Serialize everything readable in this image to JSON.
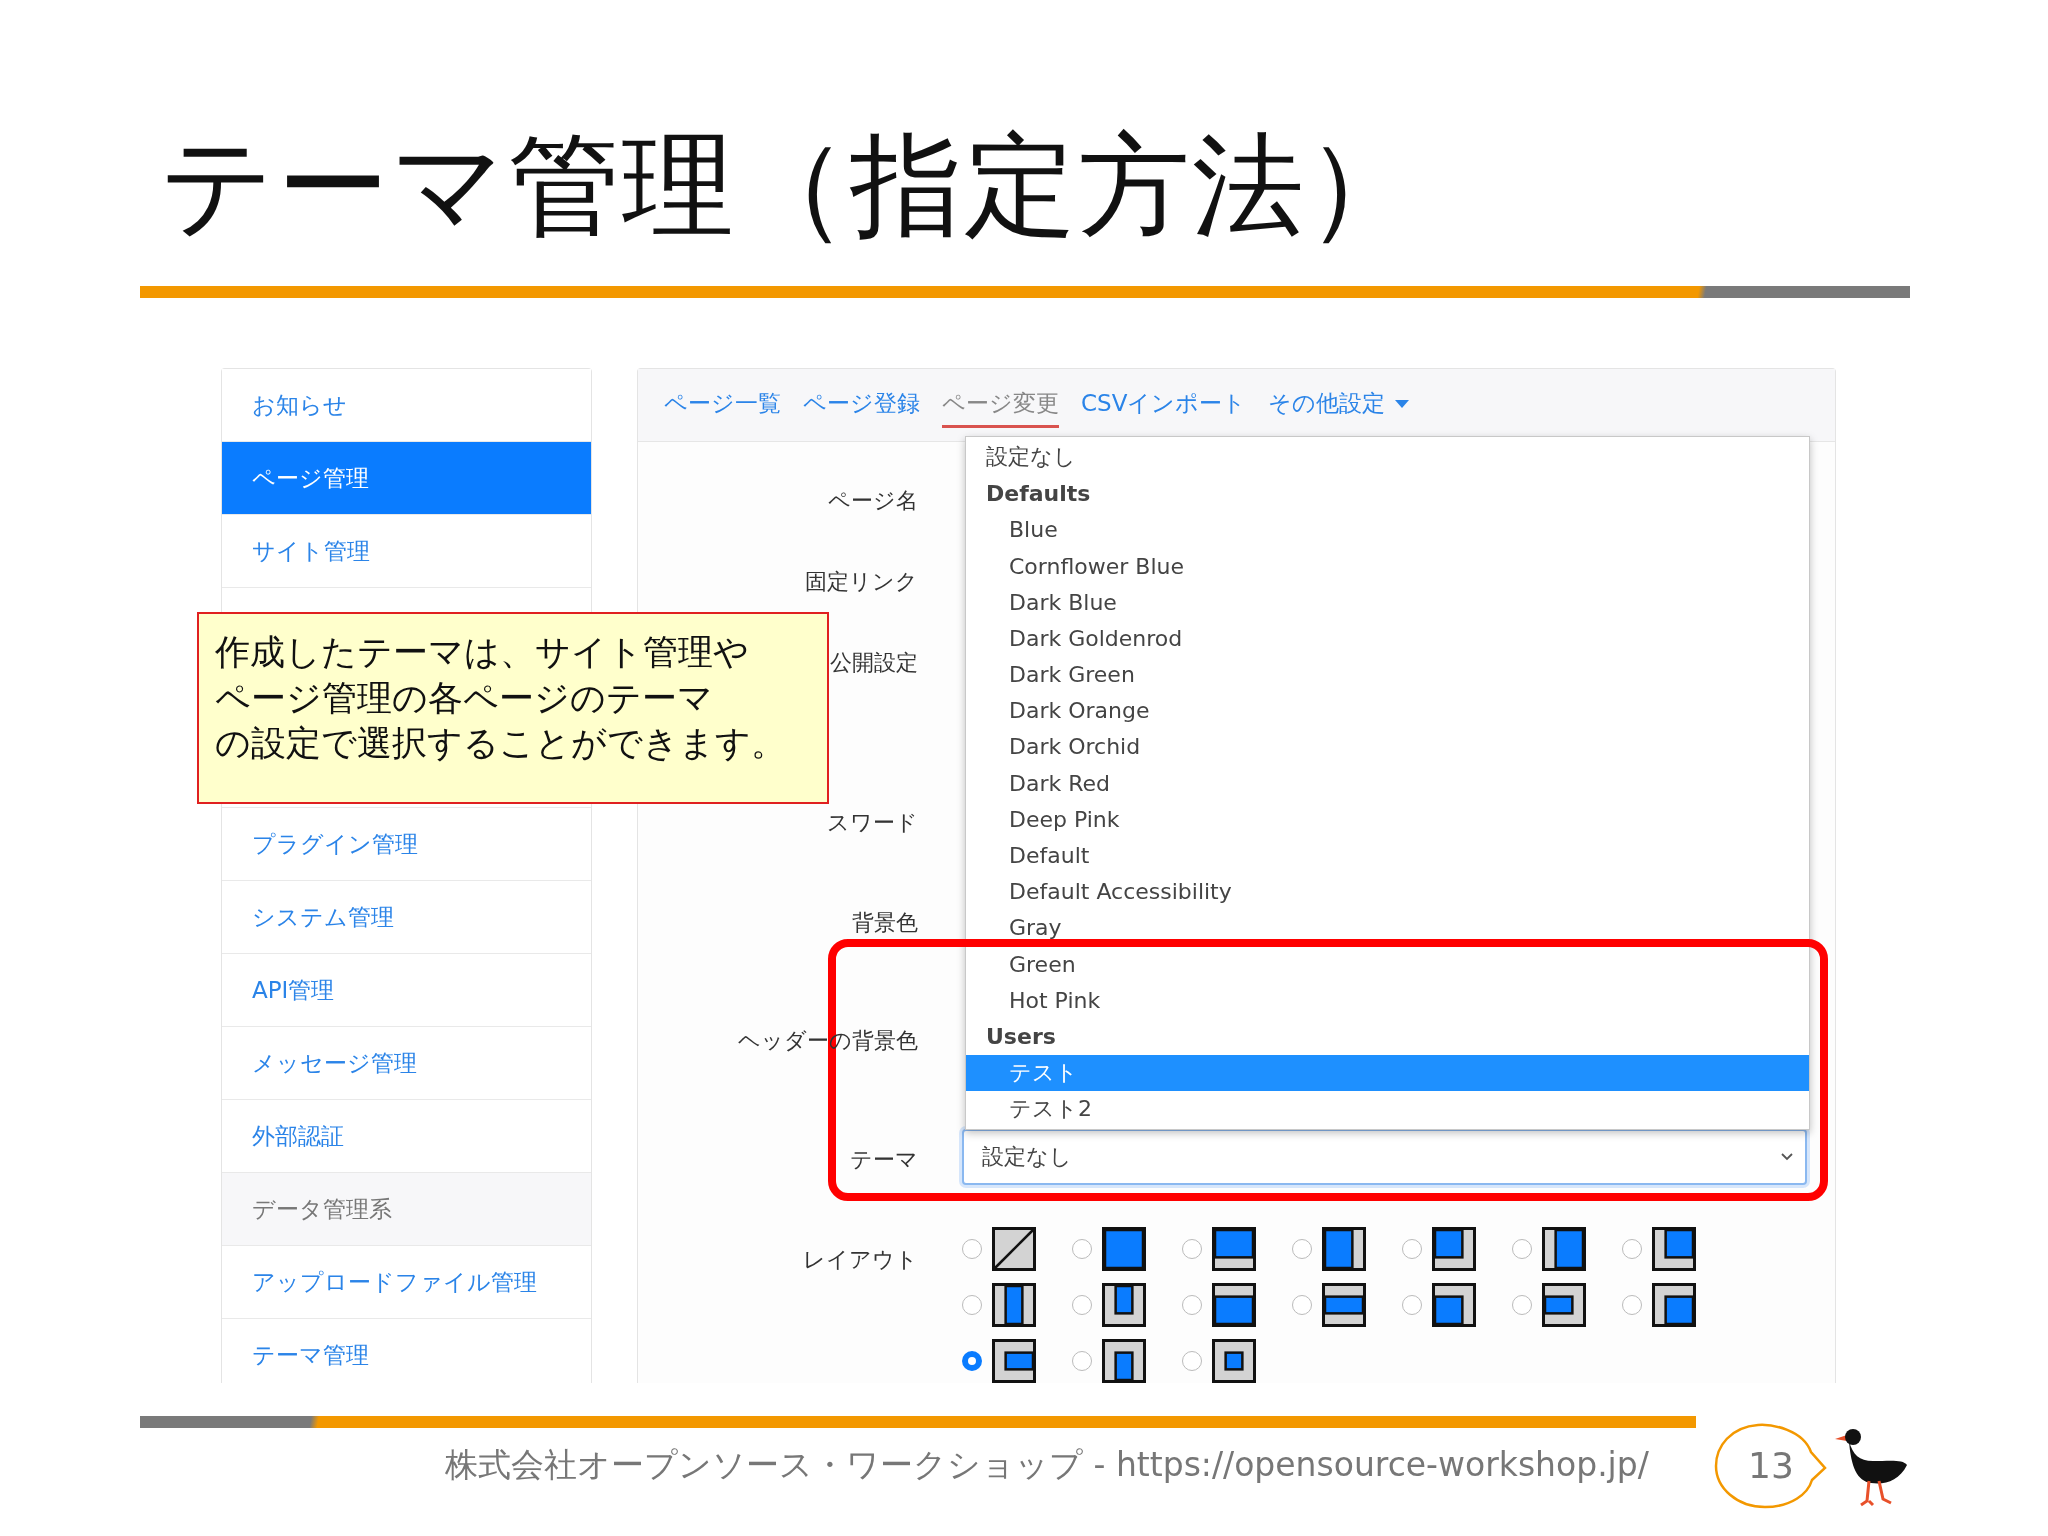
{
  "slide": {
    "title": "テーマ管理（指定方法）"
  },
  "sidebar": {
    "items": [
      {
        "label": "お知らせ",
        "kind": "link",
        "selected": false
      },
      {
        "label": "ページ管理",
        "kind": "link",
        "selected": true
      },
      {
        "label": "サイト管理",
        "kind": "link",
        "selected": false
      }
    ],
    "more_items": [
      {
        "label": "プラグイン管理",
        "kind": "link",
        "selected": false
      },
      {
        "label": "システム管理",
        "kind": "link",
        "selected": false
      },
      {
        "label": "API管理",
        "kind": "link",
        "selected": false
      },
      {
        "label": "メッセージ管理",
        "kind": "link",
        "selected": false
      },
      {
        "label": "外部認証",
        "kind": "link",
        "selected": false
      },
      {
        "label": "データ管理系",
        "kind": "header"
      },
      {
        "label": "アップロードファイル管理",
        "kind": "link",
        "selected": false
      },
      {
        "label": "テーマ管理",
        "kind": "link",
        "selected": false
      }
    ]
  },
  "tabs": [
    {
      "label": "ページ一覧",
      "selected": false,
      "has_caret": false
    },
    {
      "label": "ページ登録",
      "selected": false,
      "has_caret": false
    },
    {
      "label": "ページ変更",
      "selected": true,
      "has_caret": false
    },
    {
      "label": "CSVインポート",
      "selected": false,
      "has_caret": false
    },
    {
      "label": "その他設定",
      "selected": false,
      "has_caret": true
    }
  ],
  "form": {
    "labels": [
      "ページ名",
      "固定リンク",
      "公開設定",
      "スワード",
      "背景色",
      "ヘッダーの背景色",
      "テーマ",
      "レイアウト"
    ],
    "theme_select": {
      "value": "設定なし"
    },
    "dropdown": {
      "options": [
        {
          "label": "設定なし",
          "kind": "top",
          "selected": false
        },
        {
          "label": "Defaults",
          "kind": "group",
          "selected": false
        },
        {
          "label": "Blue",
          "kind": "item",
          "selected": false
        },
        {
          "label": "Cornflower Blue",
          "kind": "item",
          "selected": false
        },
        {
          "label": "Dark Blue",
          "kind": "item",
          "selected": false
        },
        {
          "label": "Dark Goldenrod",
          "kind": "item",
          "selected": false
        },
        {
          "label": "Dark Green",
          "kind": "item",
          "selected": false
        },
        {
          "label": "Dark Orange",
          "kind": "item",
          "selected": false
        },
        {
          "label": "Dark Orchid",
          "kind": "item",
          "selected": false
        },
        {
          "label": "Dark Red",
          "kind": "item",
          "selected": false
        },
        {
          "label": "Deep Pink",
          "kind": "item",
          "selected": false
        },
        {
          "label": "Default",
          "kind": "item",
          "selected": false
        },
        {
          "label": "Default Accessibility",
          "kind": "item",
          "selected": false
        },
        {
          "label": "Gray",
          "kind": "item",
          "selected": false
        },
        {
          "label": "Green",
          "kind": "item",
          "selected": false
        },
        {
          "label": "Hot Pink",
          "kind": "item",
          "selected": false
        },
        {
          "label": "Users",
          "kind": "group",
          "selected": false
        },
        {
          "label": "テスト",
          "kind": "item",
          "selected": true
        },
        {
          "label": "テスト2",
          "kind": "item",
          "selected": false
        }
      ]
    },
    "layouts": [
      {
        "selected": false
      },
      {
        "selected": false
      },
      {
        "selected": false
      },
      {
        "selected": false
      },
      {
        "selected": false
      },
      {
        "selected": false
      },
      {
        "selected": false
      },
      {
        "selected": false
      },
      {
        "selected": false
      },
      {
        "selected": false
      },
      {
        "selected": false
      },
      {
        "selected": false
      },
      {
        "selected": false
      },
      {
        "selected": false
      },
      {
        "selected": true
      },
      {
        "selected": false
      },
      {
        "selected": false
      }
    ]
  },
  "callout": {
    "lines": [
      "作成したテーマは、サイト管理や",
      "ページ管理の各ページのテーマ",
      "の設定で選択することができます。"
    ]
  },
  "footer": {
    "text": "株式会社オープンソース・ワークショップ - https://opensource-workshop.jp/",
    "page": "13"
  }
}
